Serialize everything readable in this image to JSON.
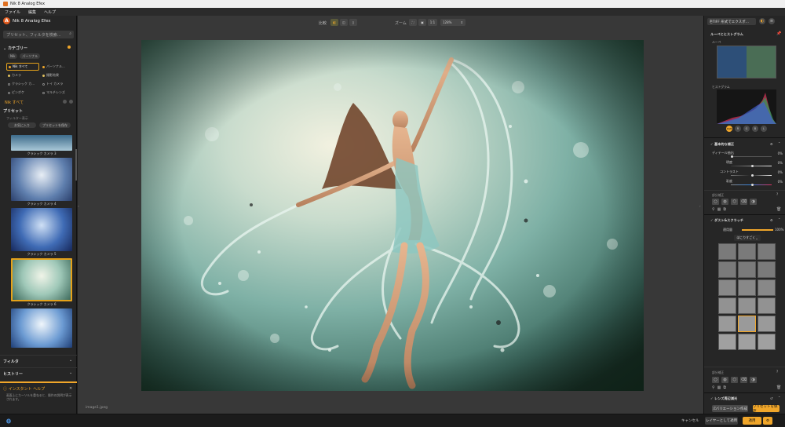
{
  "window": {
    "title": "Nik 8 Analog Efex"
  },
  "menu": [
    "ファイル",
    "編集",
    "ヘルプ"
  ],
  "left": {
    "app_name": "Nik 8 Analog Efex",
    "search_placeholder": "プリセット、フィルタを検索...",
    "category_title": "カテゴリー",
    "chips": [
      "Nik",
      "パーソナル"
    ],
    "categories": [
      {
        "label": "Nik すべて",
        "color": "#f0a62a",
        "selected": true
      },
      {
        "label": "パーソナル...",
        "color": "#f0a62a",
        "selected": false
      },
      {
        "label": "カメラ",
        "color": "#e0c060",
        "selected": false
      },
      {
        "label": "撮影効果",
        "color": "#e0c060",
        "selected": false
      },
      {
        "label": "クラシック カ...",
        "color": "#ccc",
        "selected": false
      },
      {
        "label": "トイ カメラ",
        "color": "#ccc",
        "selected": false
      },
      {
        "label": "ピンボケ",
        "color": "#ccc",
        "selected": false
      },
      {
        "label": "マルチレンズ",
        "color": "#ccc",
        "selected": false
      }
    ],
    "active_filter": "Nik すべて",
    "presets_title": "プリセット",
    "filter_info": "フィルター表示",
    "add_favorite": "お気に入り",
    "add_preset": "プリセットを保存",
    "thumbs": [
      {
        "label": "クラシック カメラ 3"
      },
      {
        "label": "クラシック カメラ 4"
      },
      {
        "label": "クラシック カメラ 5"
      },
      {
        "label": "クラシック カメラ 6"
      }
    ],
    "filters_title": "フィルタ",
    "history_title": "ヒストリー",
    "instant_help_title": "インスタント ヘルプ",
    "instant_help_text": "画面上にカーソルを重ねると、操作の説明が表示されます。"
  },
  "center": {
    "compare_label": "比較",
    "zoom_label": "ズーム",
    "zoom_ratio": "1:1",
    "zoom_value": "128%",
    "filename": "image1.jpeg"
  },
  "right": {
    "format": "TIFF 形式でエクスポ...",
    "loupe_title": "ルーペとヒストグラム",
    "loupe_label": "ルーペ",
    "histogram_label": "ヒストグラム",
    "channels": [
      "RGB",
      "R",
      "G",
      "B",
      "L"
    ],
    "basic_title": "基本的な補正",
    "sliders": [
      {
        "label": "ディテール抽出",
        "value": "0%"
      },
      {
        "label": "明度",
        "value": "0%"
      },
      {
        "label": "コントラスト",
        "value": "0%"
      },
      {
        "label": "彩度",
        "value": "0%"
      }
    ],
    "control_points": "部分補正",
    "dust_title": "ダスト&スクラッチ",
    "opacity_label": "適用量",
    "opacity_value": "100%",
    "style_label": "ほこりすごく",
    "control_points2": "部分補正",
    "lens_title": "レンズ周辺減光",
    "variation_btn": "バリエーション作成",
    "save_preset_btn": "プリセットを保存"
  },
  "bottom": {
    "cancel": "キャンセル",
    "save_as_layer": "レイヤーとして適用",
    "apply": "適用"
  }
}
